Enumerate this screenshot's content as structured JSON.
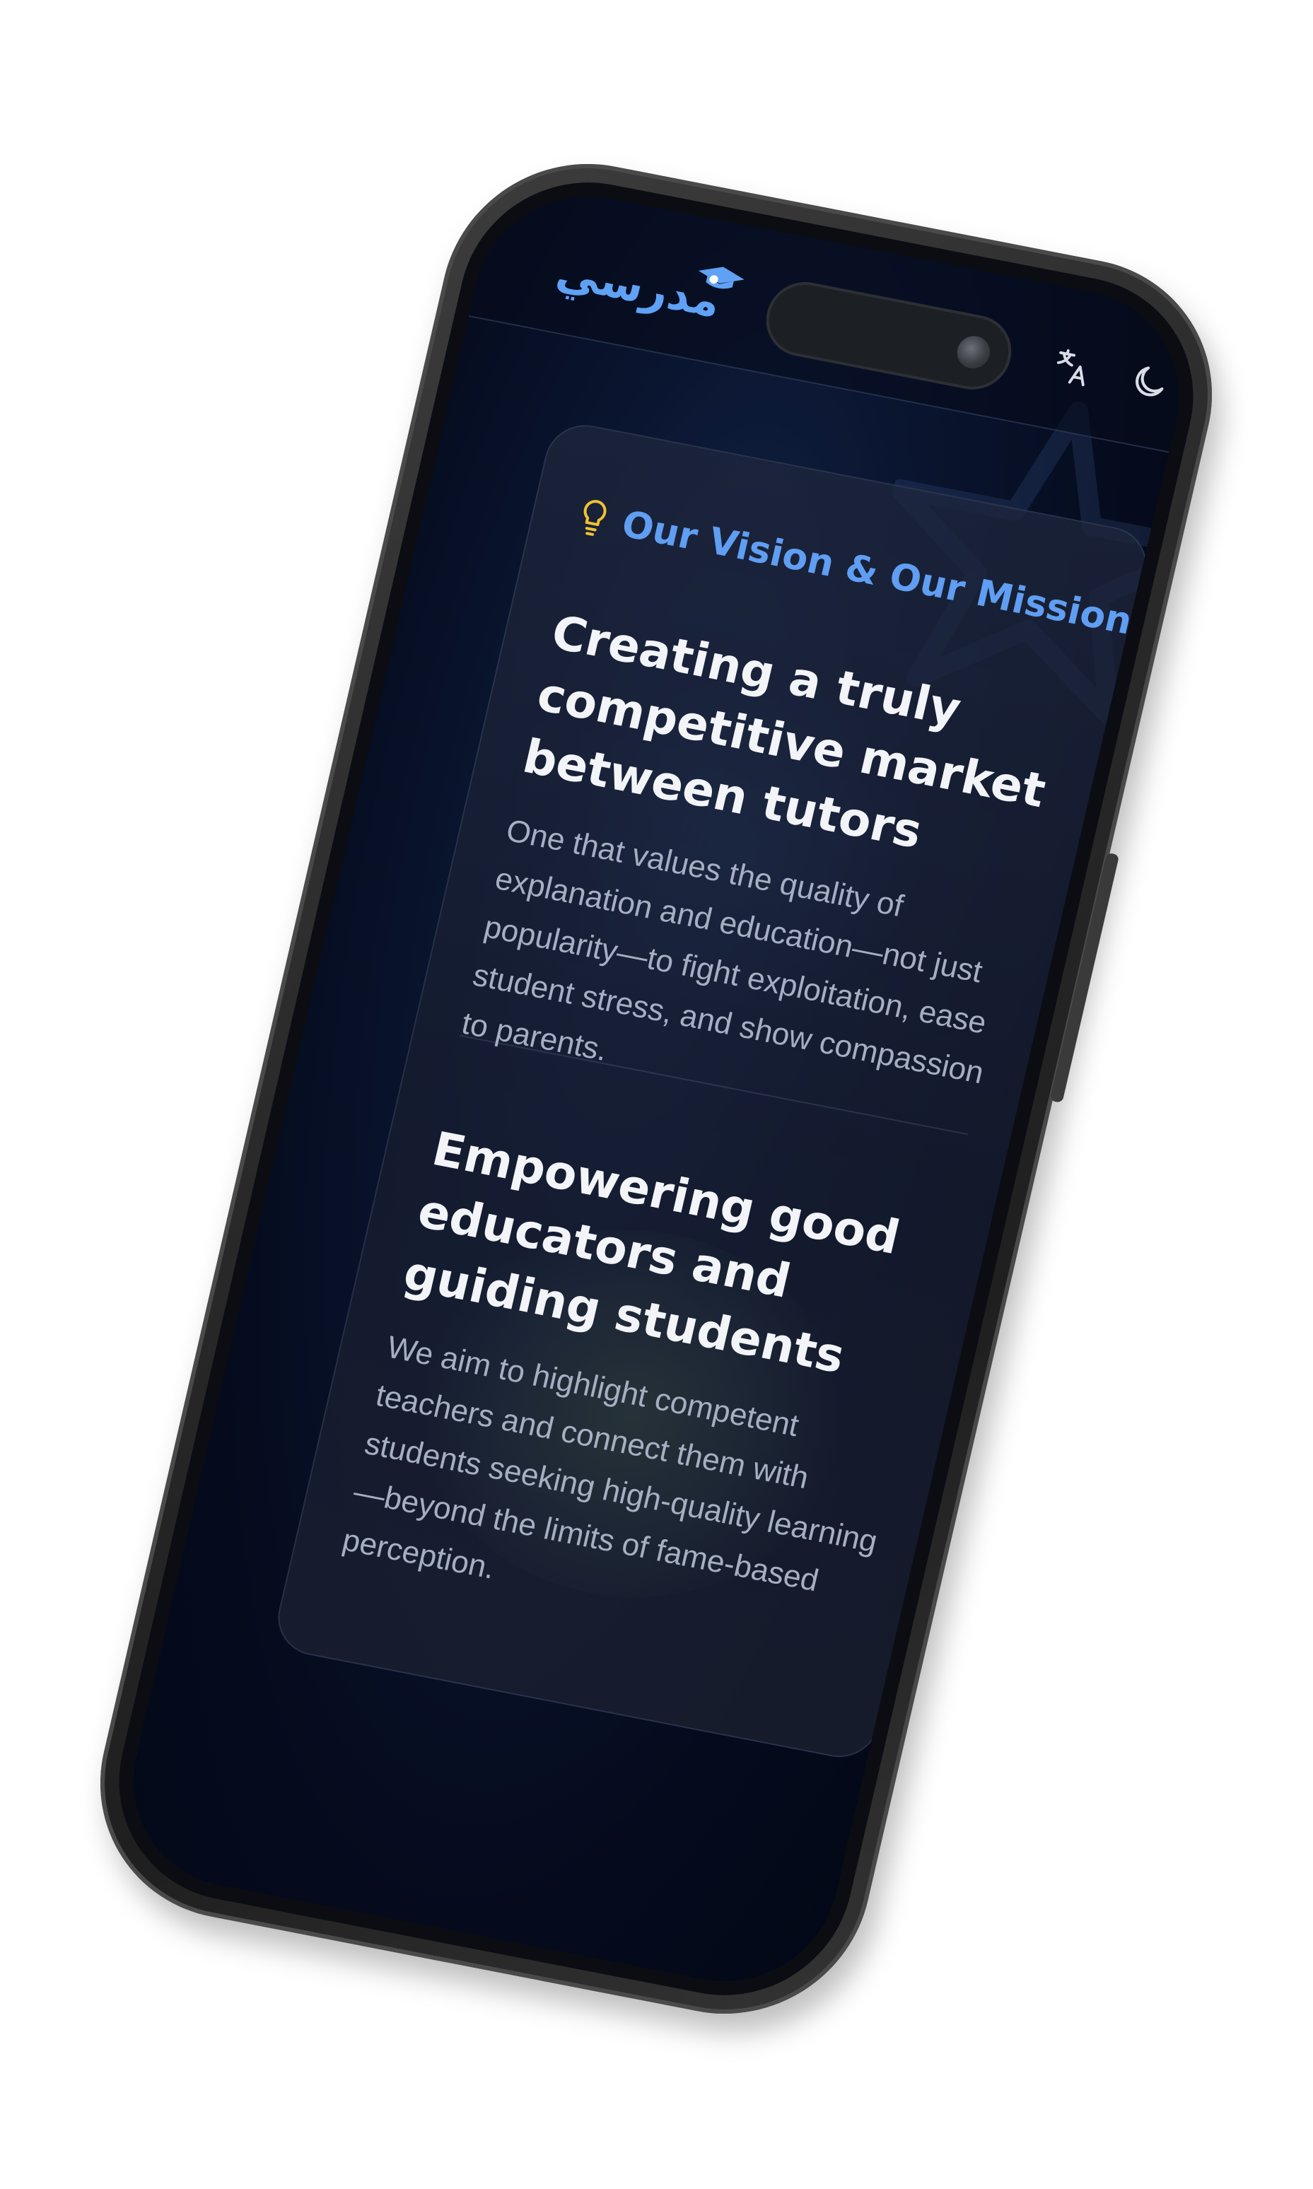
{
  "header": {
    "logo_text": "مدرسي",
    "icons": [
      "graduation-cap-icon",
      "translate-icon",
      "moon-icon",
      "menu-icon"
    ]
  },
  "card": {
    "eyebrow_icon": "lightbulb-icon",
    "eyebrow": "Our Vision & Our Mission",
    "sections": [
      {
        "title": "Creating a truly competitive market between tutors",
        "body": "One that values the quality of explanation and education—not just popularity—to fight exploitation, ease student stress, and show compassion to parents."
      },
      {
        "title": "Empowering good educators and guiding students",
        "body": "We aim to highlight competent teachers and connect them with students seeking high-quality learning—beyond the limits of fame-based perception."
      }
    ]
  },
  "colors": {
    "accent": "#5f9ef2",
    "bulb": "#f1c232",
    "background": "#050b1d",
    "card": "#1e263c",
    "heading": "#f2f4f8",
    "body": "#a6afc2"
  }
}
